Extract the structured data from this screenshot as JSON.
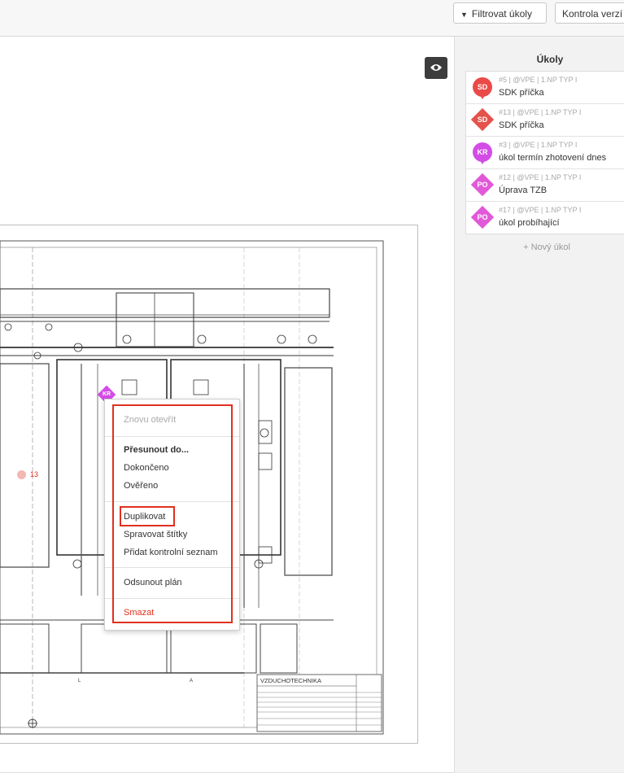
{
  "toolbar": {
    "filter_label": "Filtrovat úkoly",
    "versions_label": "Kontrola verzí"
  },
  "plan": {
    "markers": [
      {
        "badge": "KR",
        "color": "#d34ce6"
      },
      {
        "badge": "13",
        "color": "#e0301e"
      }
    ]
  },
  "tasks_panel": {
    "title": "Úkoly",
    "items": [
      {
        "meta": "#5 | @VPE | 1.NP TYP I",
        "name": "SDK příčka",
        "badge": "SD",
        "shape": "pin",
        "color": "#ea4a48",
        "checked": false
      },
      {
        "meta": "#13 | @VPE | 1.NP TYP I",
        "name": "SDK příčka",
        "badge": "SD",
        "shape": "diamond",
        "color": "#e5524b",
        "checked": false
      },
      {
        "meta": "#3 | @VPE | 1.NP TYP I",
        "name": "úkol termín zhotovení dnes",
        "badge": "KR",
        "shape": "pin",
        "color": "#d34ce6",
        "checked": true
      },
      {
        "meta": "#12 | @VPE | 1.NP TYP I",
        "name": "Úprava TZB",
        "badge": "PO",
        "shape": "diamond",
        "color": "#e158d8",
        "checked": false
      },
      {
        "meta": "#17 | @VPE | 1.NP TYP I",
        "name": "úkol probíhající",
        "badge": "PO",
        "shape": "diamond",
        "color": "#e158d8",
        "checked": false
      }
    ],
    "new_task_label": "+ Nový úkol"
  },
  "context_menu": {
    "reopen": "Znovu otevřít",
    "move_to": "Přesunout do...",
    "completed": "Dokončeno",
    "verified": "Ověřeno",
    "duplicate": "Duplikovat",
    "manage_tags": "Spravovat štítky",
    "add_checklist": "Přidat kontrolní seznam",
    "move_plan": "Odsunout plán",
    "delete": "Smazat"
  },
  "drawing_titleblock": {
    "title": "VZDUCHOTECHNIKA"
  },
  "colors": {
    "accent_red": "#e0301e",
    "dark_button": "#3c3c3c"
  }
}
